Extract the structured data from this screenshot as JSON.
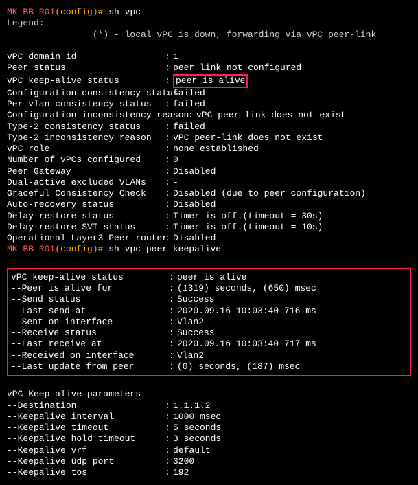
{
  "prompt": {
    "host": "MK-BB-R01",
    "cfg": "(config)#"
  },
  "cmd1": "sh vpc",
  "header_legend": "Legend:",
  "header_note": "                (*) - local vPC is down, forwarding via vPC peer-link",
  "vpc": [
    {
      "label": "vPC domain id",
      "value": "1"
    },
    {
      "label": "Peer status",
      "value": "peer link not configured"
    },
    {
      "label": "vPC keep-alive status",
      "value": "peer is alive",
      "highlight": true
    },
    {
      "label": "Configuration consistency status",
      "value": "failed"
    },
    {
      "label": "Per-vlan consistency status",
      "value": "failed"
    },
    {
      "label": "Configuration inconsistency reason",
      "value": "vPC peer-link does not exist",
      "wide": true
    },
    {
      "label": "Type-2 consistency status",
      "value": "failed"
    },
    {
      "label": "Type-2 inconsistency reason",
      "value": "vPC peer-link does not exist"
    },
    {
      "label": "vPC role",
      "value": "none established"
    },
    {
      "label": "Number of vPCs configured",
      "value": "0"
    },
    {
      "label": "Peer Gateway",
      "value": "Disabled"
    },
    {
      "label": "Dual-active excluded VLANs",
      "value": "-"
    },
    {
      "label": "Graceful Consistency Check",
      "value": "Disabled (due to peer configuration)"
    },
    {
      "label": "Auto-recovery status",
      "value": "Disabled"
    },
    {
      "label": "Delay-restore status",
      "value": "Timer is off.(timeout = 30s)"
    },
    {
      "label": "Delay-restore SVI status",
      "value": "Timer is off.(timeout = 10s)"
    },
    {
      "label": "Operational Layer3 Peer-router",
      "value": "Disabled"
    }
  ],
  "cmd2": "sh vpc peer-keepalive",
  "ka_status": [
    {
      "label": "vPC keep-alive status",
      "value": "peer is alive"
    },
    {
      "label": "--Peer is alive for",
      "value": "(1319) seconds, (650) msec"
    },
    {
      "label": "--Send status",
      "value": "Success"
    },
    {
      "label": "--Last send at",
      "value": "2020.09.16 10:03:40 716 ms"
    },
    {
      "label": "--Sent on interface",
      "value": "Vlan2"
    },
    {
      "label": "--Receive status",
      "value": "Success"
    },
    {
      "label": "--Last receive at",
      "value": "2020.09.16 10:03:40 717 ms"
    },
    {
      "label": "--Received on interface",
      "value": "Vlan2"
    },
    {
      "label": "--Last update from peer",
      "value": "(0) seconds, (187) msec"
    }
  ],
  "ka_params_header": "vPC Keep-alive parameters",
  "ka_params": [
    {
      "label": "--Destination",
      "value": "1.1.1.2"
    },
    {
      "label": "--Keepalive interval",
      "value": "1000 msec"
    },
    {
      "label": "--Keepalive timeout",
      "value": "5 seconds"
    },
    {
      "label": "--Keepalive hold timeout",
      "value": "3 seconds"
    },
    {
      "label": "--Keepalive vrf",
      "value": "default"
    },
    {
      "label": "--Keepalive udp port",
      "value": "3200"
    },
    {
      "label": "--Keepalive tos",
      "value": "192"
    }
  ]
}
